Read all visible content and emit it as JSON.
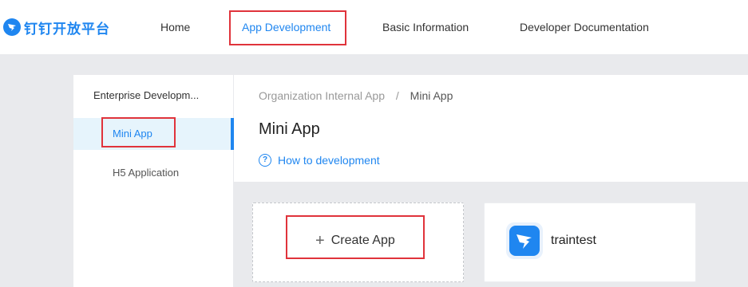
{
  "brand": {
    "logo_text": "钉钉开放平台",
    "accent_color": "#1f86f0",
    "highlight_color": "#e0333b"
  },
  "nav": {
    "items": [
      {
        "label": "Home"
      },
      {
        "label": "App Development"
      },
      {
        "label": "Basic Information"
      },
      {
        "label": "Developer Documentation"
      }
    ],
    "active": "App Development"
  },
  "sidebar": {
    "title": "Enterprise Developm...",
    "items": [
      {
        "label": "Mini App"
      },
      {
        "label": "H5 Application"
      }
    ],
    "active": "Mini App"
  },
  "breadcrumb": {
    "parent": "Organization Internal App",
    "separator": "/",
    "current": "Mini App"
  },
  "page": {
    "title": "Mini App",
    "help_link": "How to development",
    "help_icon": "question-circle-icon"
  },
  "cards": {
    "create": {
      "label": "Create App",
      "icon": "plus-icon"
    },
    "apps": [
      {
        "name": "traintest",
        "icon": "dingtalk-icon"
      }
    ]
  }
}
